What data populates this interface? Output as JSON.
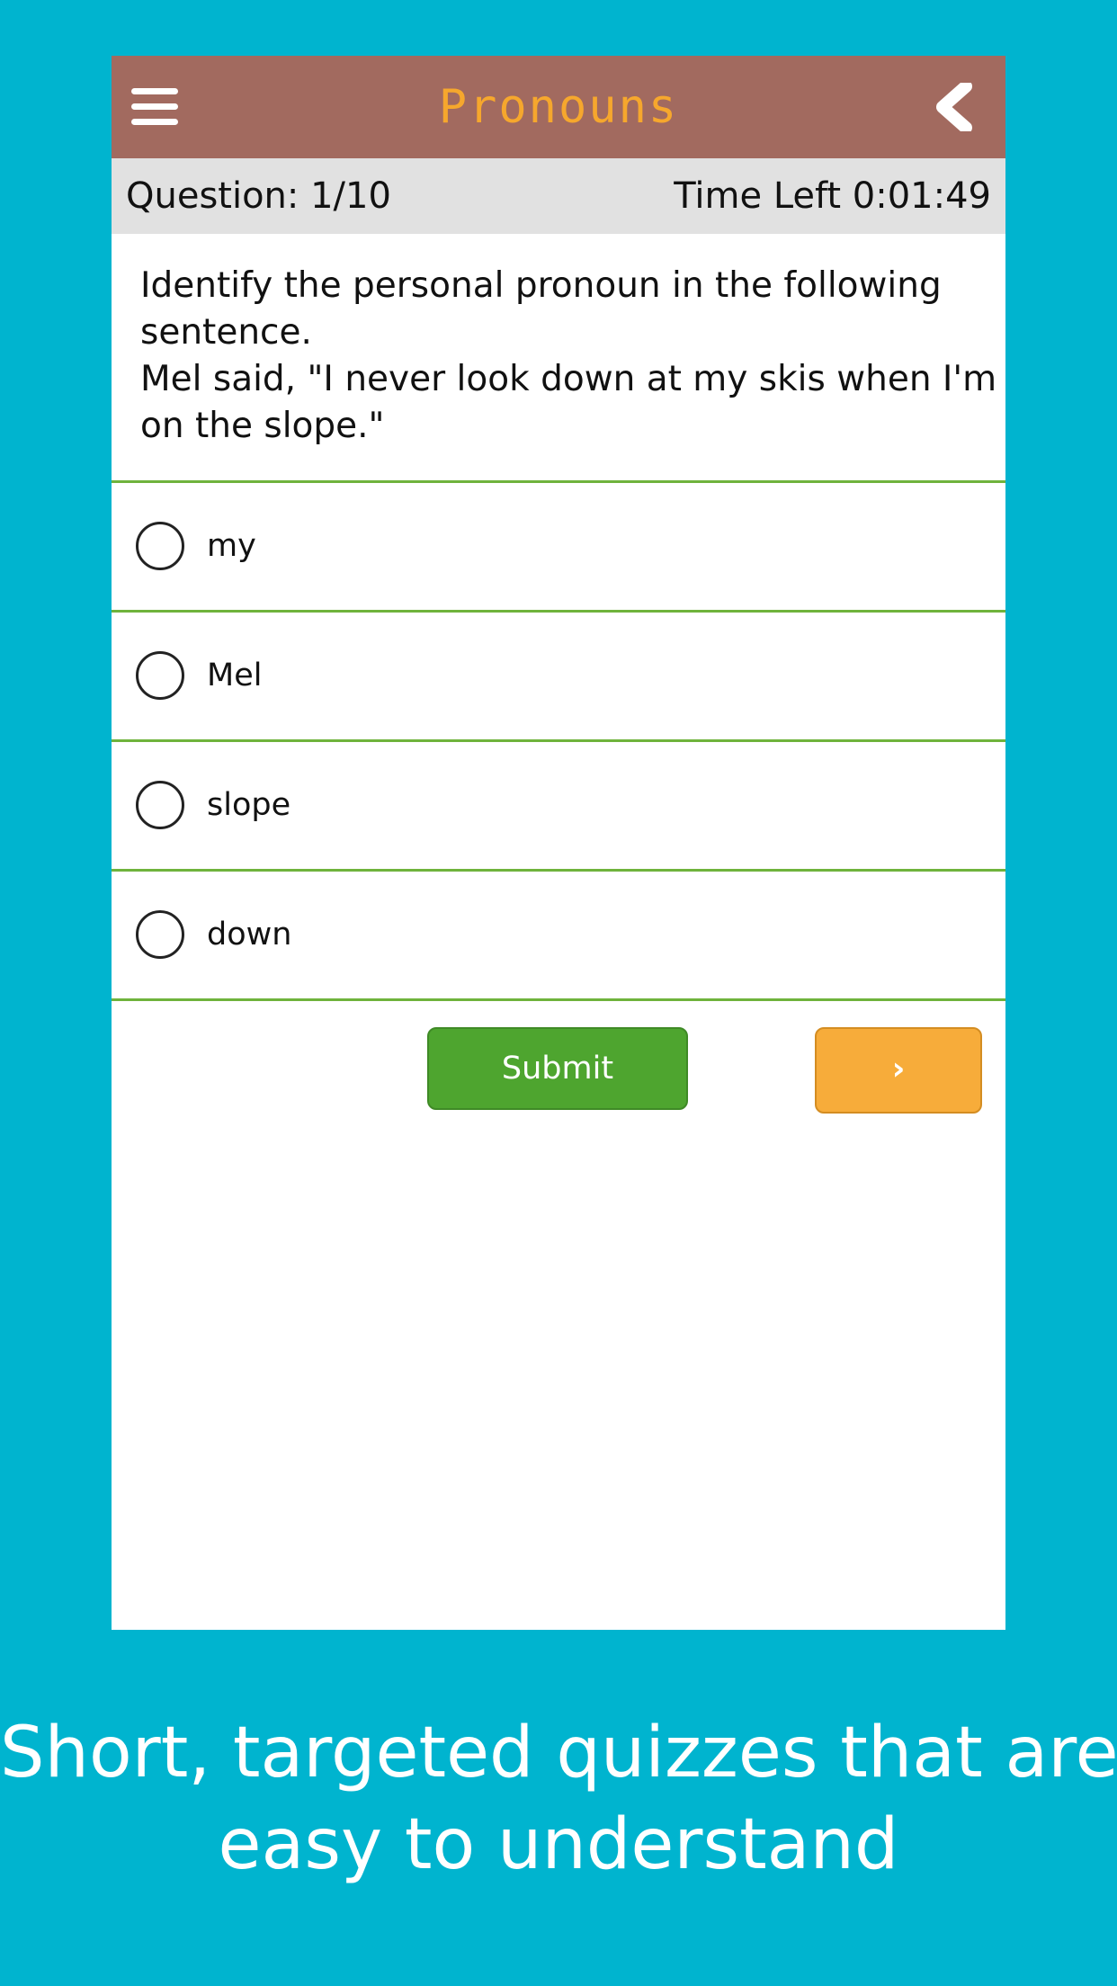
{
  "header": {
    "title": "Pronouns",
    "menu_icon": "hamburger-menu-icon",
    "back_icon": "chevron-left-icon"
  },
  "status": {
    "question_count": "Question: 1/10",
    "time_left": "Time Left 0:01:49"
  },
  "question": {
    "lines": [
      "Identify the personal pronoun in the following",
      "sentence.",
      "Mel said, \"I never look down at my skis when I'm",
      "on the slope.\""
    ]
  },
  "options": [
    {
      "label": "my",
      "selected": false
    },
    {
      "label": "Mel",
      "selected": false
    },
    {
      "label": "slope",
      "selected": false
    },
    {
      "label": "down",
      "selected": false
    }
  ],
  "actions": {
    "submit_label": "Submit",
    "next_label": "›"
  },
  "tagline": {
    "lines": [
      "Short, targeted quizzes that are",
      "easy to understand"
    ]
  },
  "colors": {
    "background": "#00b4cf",
    "header": "#a26a5f",
    "title": "#f6a72d",
    "status_bar": "#e1e1e1",
    "divider": "#6fb33c",
    "submit": "#4ea52f",
    "next": "#f7ac3a"
  }
}
